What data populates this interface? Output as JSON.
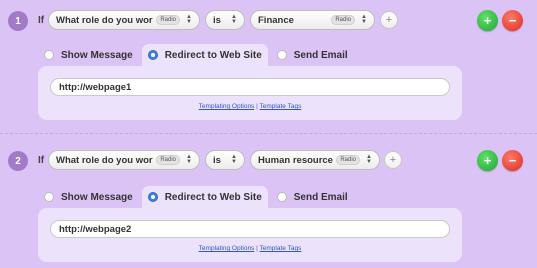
{
  "accent_colors": {
    "background": "#dcc3f5",
    "panel": "#ede2fb",
    "add": "#2fb93d",
    "remove": "#ef3a2c",
    "radio_on": "#3b82e0"
  },
  "rules": [
    {
      "number": "1",
      "if_label": "If",
      "question": "What role do you work in",
      "question_tag": "Radio",
      "operator": "is",
      "value": "Finance",
      "value_tag": "Radio",
      "add_condition": "+",
      "add_rule": "+",
      "remove_rule": "−",
      "actions": {
        "show_message": "Show Message",
        "redirect": "Redirect to Web Site",
        "send_email": "Send Email",
        "selected": "redirect"
      },
      "url": "http://webpage1",
      "templating_options": "Templating Options",
      "separator": "|",
      "template_tags": "Template Tags"
    },
    {
      "number": "2",
      "if_label": "If",
      "question": "What role do you work in",
      "question_tag": "Radio",
      "operator": "is",
      "value": "Human resources",
      "value_tag": "Radio",
      "add_condition": "+",
      "add_rule": "+",
      "remove_rule": "−",
      "actions": {
        "show_message": "Show Message",
        "redirect": "Redirect to Web Site",
        "send_email": "Send Email",
        "selected": "redirect"
      },
      "url": "http://webpage2",
      "templating_options": "Templating Options",
      "separator": "|",
      "template_tags": "Template Tags"
    }
  ]
}
